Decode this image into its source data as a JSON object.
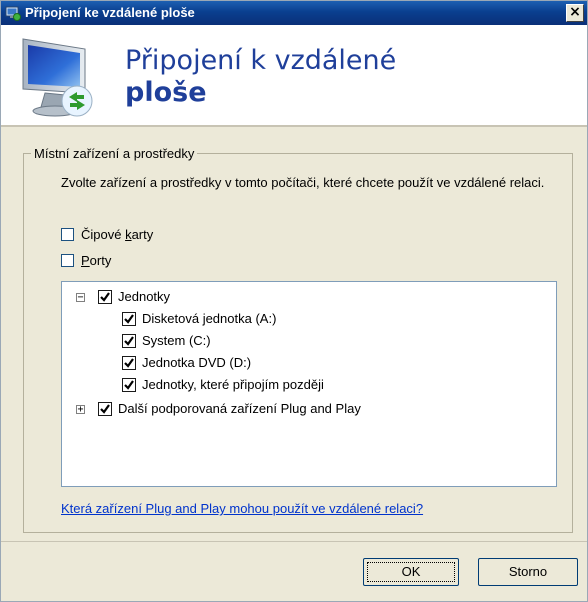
{
  "window": {
    "title": "Připojení ke vzdálené ploše",
    "close_glyph": "×"
  },
  "banner": {
    "title_line1": "Připojení k vzdálené",
    "title_line2": "ploše",
    "icon": "remote-desktop-monitor-icon"
  },
  "group": {
    "label": "Místní zařízení a prostředky",
    "description": "Zvolte zařízení a prostředky v tomto počítači, které chcete použít ve vzdálené relaci.",
    "options": [
      {
        "label_pre": "Čipové ",
        "label_accel": "k",
        "label_post": "arty",
        "checked": false
      },
      {
        "label_pre": "",
        "label_accel": "P",
        "label_post": "orty",
        "checked": false
      }
    ]
  },
  "tree": {
    "nodes": [
      {
        "label": "Jednotky",
        "expander": "−",
        "checked": true
      },
      {
        "label": "Disketová jednotka (A:)",
        "checked": true
      },
      {
        "label": "System (C:)",
        "checked": true
      },
      {
        "label": "Jednotka DVD (D:)",
        "checked": true
      },
      {
        "label": "Jednotky, které připojím později",
        "checked": true
      },
      {
        "label": "Další podporovaná zařízení Plug and Play",
        "expander": "+",
        "checked": true
      }
    ]
  },
  "link": {
    "text": "Která zařízení Plug and Play mohou použít ve vzdálené relaci?"
  },
  "buttons": {
    "ok": "OK",
    "cancel": "Storno"
  },
  "colors": {
    "title_bar": "#0a3f8f",
    "banner_text": "#1f3f9a",
    "link": "#0033cc",
    "dialog_bg": "#ece9d8"
  }
}
